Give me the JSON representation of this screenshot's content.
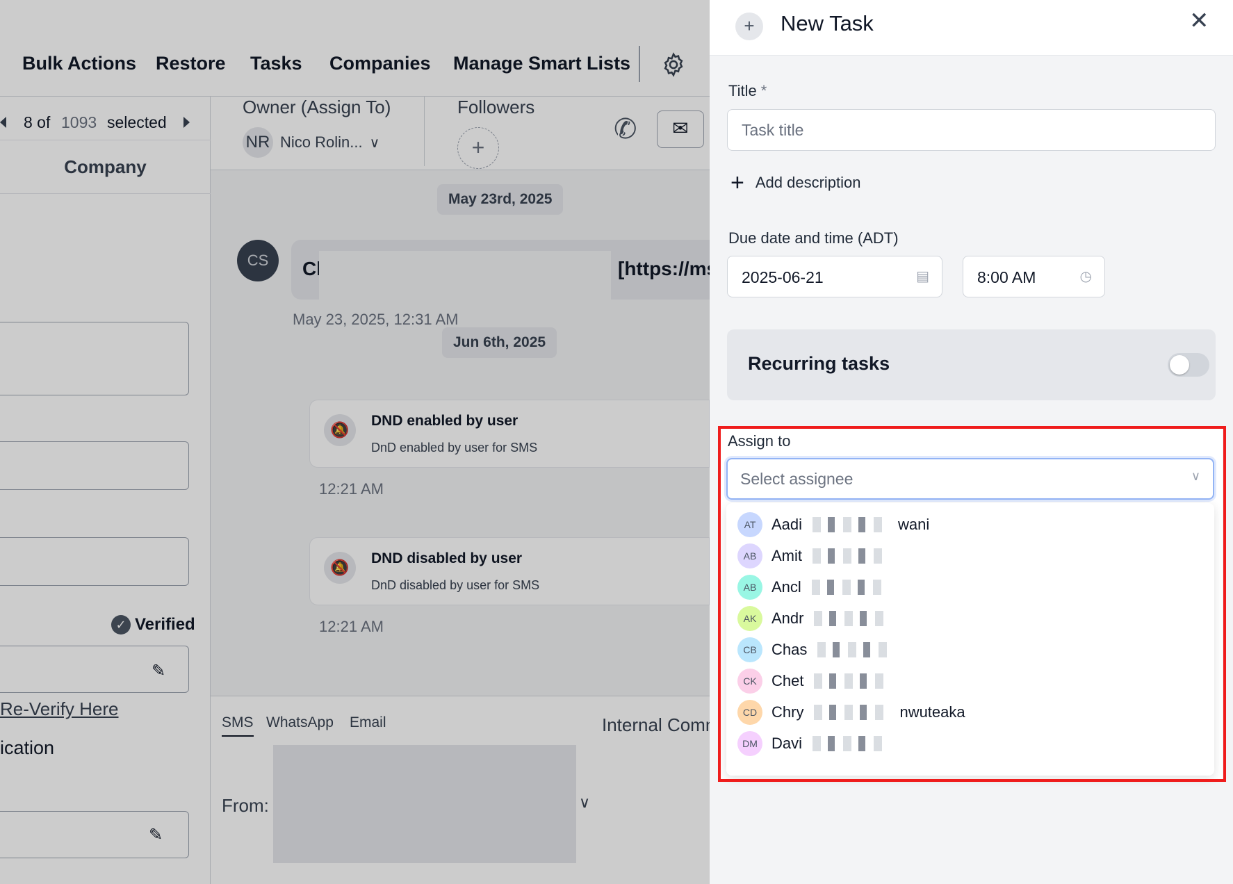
{
  "nav": {
    "items": [
      "Bulk Actions",
      "Restore",
      "Tasks",
      "Companies",
      "Manage Smart Lists"
    ],
    "settings_icon": "gear-icon"
  },
  "pager": {
    "current": "8 of",
    "total": "1093",
    "suffix": "selected"
  },
  "left": {
    "company_tab": "Company",
    "verified": "Verified",
    "reverify_link": "Re-Verify Here",
    "section_fragment": "ication"
  },
  "conversation": {
    "owner_label": "Owner (Assign To)",
    "owner_initials": "NR",
    "owner_name": "Nico Rolin...",
    "followers_label": "Followers",
    "date1": "May 23rd, 2025",
    "avatar_initials": "CS",
    "msg_prefix": "Cl",
    "msg_suffix": "[https://msg",
    "msg_time": "May 23, 2025, 12:31 AM",
    "date2": "Jun 6th, 2025",
    "dnd_enabled_title": "DND enabled by user",
    "dnd_enabled_sub": "DnD enabled by user for SMS",
    "dnd_enabled_time": "12:21 AM",
    "dnd_disabled_title": "DND disabled by user",
    "dnd_disabled_sub": "DnD disabled by user for SMS",
    "dnd_disabled_time": "12:21 AM",
    "tabs": [
      "SMS",
      "WhatsApp",
      "Email"
    ],
    "internal_tab": "Internal Comm",
    "from_label": "From:"
  },
  "task": {
    "title": "New Task",
    "title_label": "Title",
    "required_mark": "*",
    "title_placeholder": "Task title",
    "add_description": "Add description",
    "due_label": "Due date and time (ADT)",
    "due_date": "2025-06-21",
    "due_time": "8:00 AM",
    "recurring_label": "Recurring tasks",
    "recurring_enabled": false,
    "assign_label": "Assign to",
    "assign_placeholder": "Select assignee",
    "assignees": [
      {
        "initials": "AT",
        "name_start": "Aadi",
        "name_end": "wani",
        "color": "#c7d7fe"
      },
      {
        "initials": "AB",
        "name_start": "Amit",
        "name_end": "",
        "color": "#ddd6fe"
      },
      {
        "initials": "AB",
        "name_start": "Ancl",
        "name_end": "",
        "color": "#99f6e4"
      },
      {
        "initials": "AK",
        "name_start": "Andr",
        "name_end": "",
        "color": "#d9f99d"
      },
      {
        "initials": "CB",
        "name_start": "Chas",
        "name_end": "",
        "color": "#bae6fd"
      },
      {
        "initials": "CK",
        "name_start": "Chet",
        "name_end": "",
        "color": "#fbcfe8"
      },
      {
        "initials": "CD",
        "name_start": "Chry",
        "name_end": "nwuteaka",
        "color": "#fed7aa"
      },
      {
        "initials": "DM",
        "name_start": "Davi",
        "name_end": "",
        "color": "#f5d0fe"
      }
    ]
  },
  "colors": {
    "highlight": "#ef1c1c",
    "focus_ring": "#93b4f5"
  }
}
